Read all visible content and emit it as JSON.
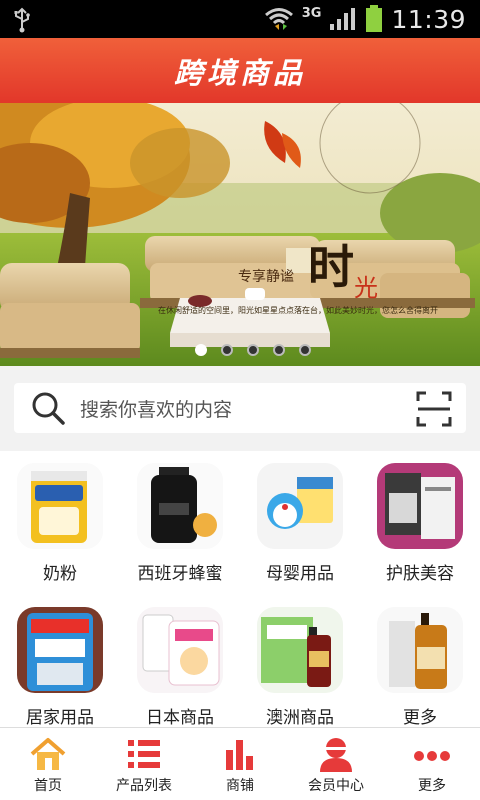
{
  "status_bar": {
    "network": "3G",
    "time": "11:39"
  },
  "header": {
    "title": "跨境商品"
  },
  "banner": {
    "tagline": "专享静谧",
    "big_char": "时",
    "small_char": "光",
    "subtitle": "在休闲舒适的空间里，阳光如星星点点落在台，如此美妙时光，您怎么舍得离开",
    "slide_count": 5,
    "active_slide": 1
  },
  "search": {
    "placeholder": "搜索你喜欢的内容"
  },
  "categories": [
    {
      "label": "奶粉"
    },
    {
      "label": "西班牙蜂蜜"
    },
    {
      "label": "母婴用品"
    },
    {
      "label": "护肤美容"
    },
    {
      "label": "居家用品"
    },
    {
      "label": "日本商品"
    },
    {
      "label": "澳洲商品"
    },
    {
      "label": "更多"
    }
  ],
  "tabs": [
    {
      "label": "首页",
      "icon": "home-icon",
      "color": "#f0a030"
    },
    {
      "label": "产品列表",
      "icon": "list-icon",
      "color": "#e63a3a"
    },
    {
      "label": "商铺",
      "icon": "bar-chart-icon",
      "color": "#e63a3a"
    },
    {
      "label": "会员中心",
      "icon": "user-icon",
      "color": "#e63a3a"
    },
    {
      "label": "更多",
      "icon": "more-dots-icon",
      "color": "#e63a3a"
    }
  ],
  "colors": {
    "brand": "#e84830",
    "accent": "#e63a3a"
  }
}
